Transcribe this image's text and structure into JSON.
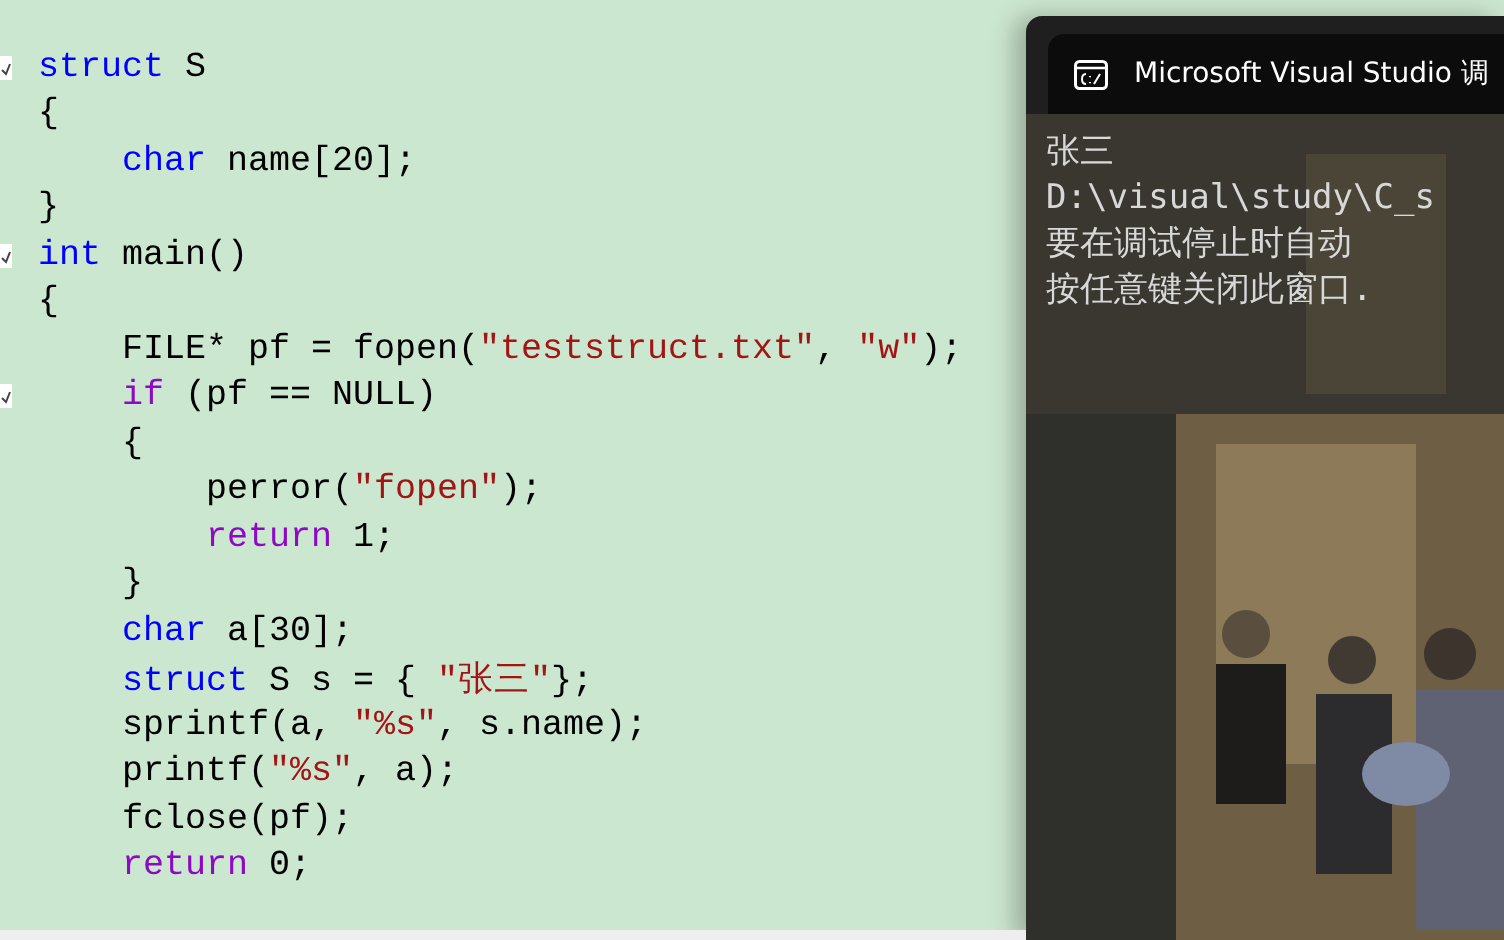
{
  "editor": {
    "lines": [
      {
        "foldable": true,
        "tokens": [
          {
            "kind": "keyword",
            "text": "struct"
          },
          {
            "kind": "plain",
            "text": " S"
          }
        ]
      },
      {
        "foldable": false,
        "tokens": [
          {
            "kind": "plain",
            "text": "{"
          }
        ],
        "children": [
          {
            "foldable": false,
            "tokens": [
              {
                "kind": "keyword",
                "text": "char"
              },
              {
                "kind": "plain",
                "text": " name[20];"
              }
            ]
          }
        ]
      },
      {
        "foldable": false,
        "tokens": [
          {
            "kind": "plain",
            "text": "}"
          }
        ]
      },
      {
        "foldable": true,
        "tokens": [
          {
            "kind": "keyword",
            "text": "int"
          },
          {
            "kind": "plain",
            "text": " main()"
          }
        ]
      },
      {
        "foldable": false,
        "tokens": [
          {
            "kind": "plain",
            "text": "{"
          }
        ],
        "children": [
          {
            "foldable": false,
            "tokens": [
              {
                "kind": "plain",
                "text": "FILE* pf = fopen("
              },
              {
                "kind": "string",
                "text": "\"teststruct.txt\""
              },
              {
                "kind": "plain",
                "text": ", "
              },
              {
                "kind": "string",
                "text": "\"w\""
              },
              {
                "kind": "plain",
                "text": ");"
              }
            ]
          },
          {
            "foldable": true,
            "tokens": [
              {
                "kind": "control",
                "text": "if"
              },
              {
                "kind": "plain",
                "text": " (pf == NULL)"
              }
            ]
          },
          {
            "foldable": false,
            "tokens": [
              {
                "kind": "plain",
                "text": "{"
              }
            ],
            "children": [
              {
                "foldable": false,
                "tokens": [
                  {
                    "kind": "plain",
                    "text": "perror("
                  },
                  {
                    "kind": "string",
                    "text": "\"fopen\""
                  },
                  {
                    "kind": "plain",
                    "text": ");"
                  }
                ]
              },
              {
                "foldable": false,
                "tokens": [
                  {
                    "kind": "control",
                    "text": "return"
                  },
                  {
                    "kind": "plain",
                    "text": " 1;"
                  }
                ]
              }
            ]
          },
          {
            "foldable": false,
            "tokens": [
              {
                "kind": "plain",
                "text": "}"
              }
            ]
          },
          {
            "foldable": false,
            "tokens": [
              {
                "kind": "keyword",
                "text": "char"
              },
              {
                "kind": "plain",
                "text": " a[30];"
              }
            ]
          },
          {
            "foldable": false,
            "tokens": [
              {
                "kind": "keyword",
                "text": "struct"
              },
              {
                "kind": "plain",
                "text": " S s = { "
              },
              {
                "kind": "string",
                "text": "\"张三\""
              },
              {
                "kind": "plain",
                "text": "};"
              }
            ]
          },
          {
            "foldable": false,
            "tokens": [
              {
                "kind": "plain",
                "text": "sprintf(a, "
              },
              {
                "kind": "string",
                "text": "\"%s\""
              },
              {
                "kind": "plain",
                "text": ", s.name);"
              }
            ]
          },
          {
            "foldable": false,
            "tokens": [
              {
                "kind": "plain",
                "text": "printf("
              },
              {
                "kind": "string",
                "text": "\"%s\""
              },
              {
                "kind": "plain",
                "text": ", a);"
              }
            ]
          },
          {
            "foldable": false,
            "tokens": [
              {
                "kind": "plain",
                "text": "fclose(pf);"
              }
            ]
          },
          {
            "foldable": false,
            "tokens": [
              {
                "kind": "control",
                "text": "return"
              },
              {
                "kind": "plain",
                "text": " 0;"
              }
            ]
          }
        ]
      }
    ]
  },
  "console": {
    "title": "Microsoft Visual Studio 调",
    "lines": [
      "张三",
      "D:\\visual\\study\\C_s",
      "要在调试停止时自动",
      "按任意键关闭此窗口."
    ]
  }
}
